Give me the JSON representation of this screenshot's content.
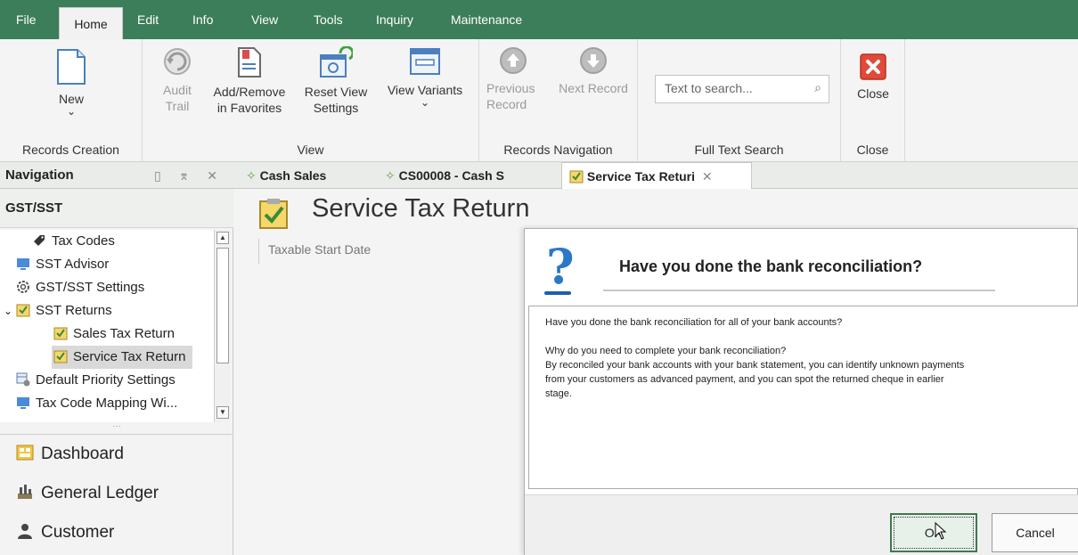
{
  "menu": {
    "items": [
      "File",
      "Home",
      "Edit",
      "Info",
      "View",
      "Tools",
      "Inquiry",
      "Maintenance"
    ],
    "active": "Home",
    "accent_color": "#3c7d5a"
  },
  "ribbon": {
    "records_creation": {
      "label": "Records Creation",
      "new_label": "New",
      "new_arrow": "⌄"
    },
    "view": {
      "label": "View",
      "audit_trail": "Audit\nTrail",
      "add_remove": "Add/Remove\nin Favorites",
      "reset_view": "Reset View\nSettings",
      "view_variants": "View Variants",
      "view_variants_arrow": "⌄"
    },
    "records_navigation": {
      "label": "Records Navigation",
      "previous": "Previous\nRecord",
      "next": "Next Record"
    },
    "full_text_search": {
      "label": "Full Text Search",
      "placeholder": "Text to search..."
    },
    "close_group": {
      "label": "Close",
      "close": "Close"
    }
  },
  "tabs": {
    "navigation_title": "Navigation",
    "navigation_controls": "▯ ⌆ ✕",
    "documents": [
      {
        "label": "Cash Sales",
        "active": false
      },
      {
        "label": "CS00008 - Cash S",
        "active": false
      },
      {
        "label": "Service Tax Returi",
        "active": true,
        "closable": true
      }
    ],
    "close_glyph": "✕"
  },
  "navigation": {
    "section": "GST/SST",
    "tree": [
      {
        "label": "Tax Codes",
        "icon": "tag-icon",
        "level": 1
      },
      {
        "label": "SST Advisor",
        "icon": "monitor-icon",
        "level": 1
      },
      {
        "label": "GST/SST Settings",
        "icon": "gear-icon",
        "level": 1
      },
      {
        "label": "SST Returns",
        "icon": "checklist-icon",
        "level": 1,
        "expanded": true,
        "expander": "⌄"
      },
      {
        "label": "Sales Tax Return",
        "icon": "checklist-icon",
        "level": 2
      },
      {
        "label": "Service Tax Return",
        "icon": "checklist-icon",
        "level": 2,
        "selected": true
      },
      {
        "label": "Default Priority Settings",
        "icon": "settings-grid-icon",
        "level": 1
      },
      {
        "label": "Tax Code Mapping Wi...",
        "icon": "monitor-icon",
        "level": 1
      }
    ],
    "splitter": "···",
    "modules": [
      {
        "label": "Dashboard",
        "icon": "dashboard-icon"
      },
      {
        "label": "General Ledger",
        "icon": "ledger-icon"
      },
      {
        "label": "Customer",
        "icon": "customer-icon"
      }
    ]
  },
  "main": {
    "title": "Service Tax Return",
    "grid_header": "Taxable Start Date"
  },
  "dialog": {
    "icon": "?",
    "title": "Have you done the bank reconciliation?",
    "body_line1": "Have you done the bank reconciliation for all of your bank accounts?",
    "body_line2": "Why do you need to complete your bank reconciliation?",
    "body_line3": "By reconciled your bank accounts with your bank statement, you can identify unknown payments",
    "body_line4": "from your customers as advanced payment, and you can spot the returned cheque in earlier",
    "body_line5": "stage.",
    "ok_label": "OK",
    "cancel_label": "Cancel"
  }
}
